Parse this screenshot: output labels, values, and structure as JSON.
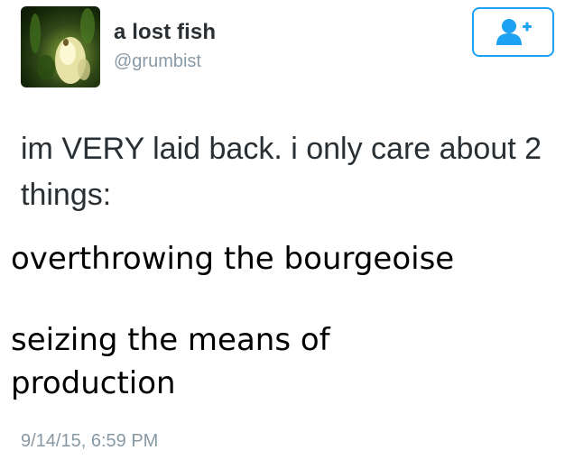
{
  "author": {
    "display_name": "a lost fish",
    "username": "@grumbist",
    "avatar_icon": "fish-avatar"
  },
  "follow_button": {
    "icon": "add-user-icon",
    "color": "#1da1f2"
  },
  "tweet": {
    "text": "im VERY laid back. i only care about 2 things:",
    "things": [
      "overthrowing the bourgeoise",
      "seizing the means of production"
    ],
    "timestamp": "9/14/15, 6:59 PM"
  },
  "colors": {
    "text": "#292f33",
    "muted": "#8899a6",
    "accent": "#1da1f2"
  }
}
